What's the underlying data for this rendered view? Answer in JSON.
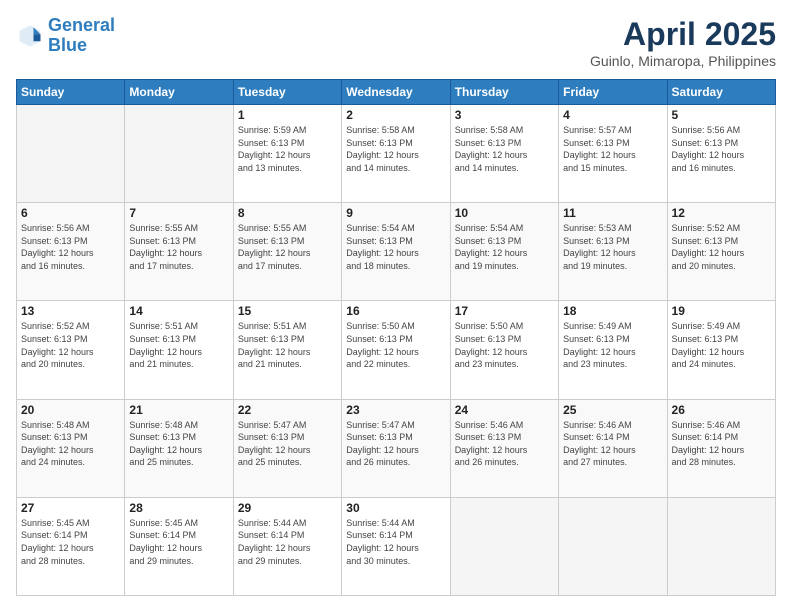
{
  "logo": {
    "line1": "General",
    "line2": "Blue"
  },
  "title": "April 2025",
  "subtitle": "Guinlo, Mimaropa, Philippines",
  "days_header": [
    "Sunday",
    "Monday",
    "Tuesday",
    "Wednesday",
    "Thursday",
    "Friday",
    "Saturday"
  ],
  "weeks": [
    [
      {
        "day": "",
        "info": ""
      },
      {
        "day": "",
        "info": ""
      },
      {
        "day": "1",
        "info": "Sunrise: 5:59 AM\nSunset: 6:13 PM\nDaylight: 12 hours\nand 13 minutes."
      },
      {
        "day": "2",
        "info": "Sunrise: 5:58 AM\nSunset: 6:13 PM\nDaylight: 12 hours\nand 14 minutes."
      },
      {
        "day": "3",
        "info": "Sunrise: 5:58 AM\nSunset: 6:13 PM\nDaylight: 12 hours\nand 14 minutes."
      },
      {
        "day": "4",
        "info": "Sunrise: 5:57 AM\nSunset: 6:13 PM\nDaylight: 12 hours\nand 15 minutes."
      },
      {
        "day": "5",
        "info": "Sunrise: 5:56 AM\nSunset: 6:13 PM\nDaylight: 12 hours\nand 16 minutes."
      }
    ],
    [
      {
        "day": "6",
        "info": "Sunrise: 5:56 AM\nSunset: 6:13 PM\nDaylight: 12 hours\nand 16 minutes."
      },
      {
        "day": "7",
        "info": "Sunrise: 5:55 AM\nSunset: 6:13 PM\nDaylight: 12 hours\nand 17 minutes."
      },
      {
        "day": "8",
        "info": "Sunrise: 5:55 AM\nSunset: 6:13 PM\nDaylight: 12 hours\nand 17 minutes."
      },
      {
        "day": "9",
        "info": "Sunrise: 5:54 AM\nSunset: 6:13 PM\nDaylight: 12 hours\nand 18 minutes."
      },
      {
        "day": "10",
        "info": "Sunrise: 5:54 AM\nSunset: 6:13 PM\nDaylight: 12 hours\nand 19 minutes."
      },
      {
        "day": "11",
        "info": "Sunrise: 5:53 AM\nSunset: 6:13 PM\nDaylight: 12 hours\nand 19 minutes."
      },
      {
        "day": "12",
        "info": "Sunrise: 5:52 AM\nSunset: 6:13 PM\nDaylight: 12 hours\nand 20 minutes."
      }
    ],
    [
      {
        "day": "13",
        "info": "Sunrise: 5:52 AM\nSunset: 6:13 PM\nDaylight: 12 hours\nand 20 minutes."
      },
      {
        "day": "14",
        "info": "Sunrise: 5:51 AM\nSunset: 6:13 PM\nDaylight: 12 hours\nand 21 minutes."
      },
      {
        "day": "15",
        "info": "Sunrise: 5:51 AM\nSunset: 6:13 PM\nDaylight: 12 hours\nand 21 minutes."
      },
      {
        "day": "16",
        "info": "Sunrise: 5:50 AM\nSunset: 6:13 PM\nDaylight: 12 hours\nand 22 minutes."
      },
      {
        "day": "17",
        "info": "Sunrise: 5:50 AM\nSunset: 6:13 PM\nDaylight: 12 hours\nand 23 minutes."
      },
      {
        "day": "18",
        "info": "Sunrise: 5:49 AM\nSunset: 6:13 PM\nDaylight: 12 hours\nand 23 minutes."
      },
      {
        "day": "19",
        "info": "Sunrise: 5:49 AM\nSunset: 6:13 PM\nDaylight: 12 hours\nand 24 minutes."
      }
    ],
    [
      {
        "day": "20",
        "info": "Sunrise: 5:48 AM\nSunset: 6:13 PM\nDaylight: 12 hours\nand 24 minutes."
      },
      {
        "day": "21",
        "info": "Sunrise: 5:48 AM\nSunset: 6:13 PM\nDaylight: 12 hours\nand 25 minutes."
      },
      {
        "day": "22",
        "info": "Sunrise: 5:47 AM\nSunset: 6:13 PM\nDaylight: 12 hours\nand 25 minutes."
      },
      {
        "day": "23",
        "info": "Sunrise: 5:47 AM\nSunset: 6:13 PM\nDaylight: 12 hours\nand 26 minutes."
      },
      {
        "day": "24",
        "info": "Sunrise: 5:46 AM\nSunset: 6:13 PM\nDaylight: 12 hours\nand 26 minutes."
      },
      {
        "day": "25",
        "info": "Sunrise: 5:46 AM\nSunset: 6:14 PM\nDaylight: 12 hours\nand 27 minutes."
      },
      {
        "day": "26",
        "info": "Sunrise: 5:46 AM\nSunset: 6:14 PM\nDaylight: 12 hours\nand 28 minutes."
      }
    ],
    [
      {
        "day": "27",
        "info": "Sunrise: 5:45 AM\nSunset: 6:14 PM\nDaylight: 12 hours\nand 28 minutes."
      },
      {
        "day": "28",
        "info": "Sunrise: 5:45 AM\nSunset: 6:14 PM\nDaylight: 12 hours\nand 29 minutes."
      },
      {
        "day": "29",
        "info": "Sunrise: 5:44 AM\nSunset: 6:14 PM\nDaylight: 12 hours\nand 29 minutes."
      },
      {
        "day": "30",
        "info": "Sunrise: 5:44 AM\nSunset: 6:14 PM\nDaylight: 12 hours\nand 30 minutes."
      },
      {
        "day": "",
        "info": ""
      },
      {
        "day": "",
        "info": ""
      },
      {
        "day": "",
        "info": ""
      }
    ]
  ]
}
